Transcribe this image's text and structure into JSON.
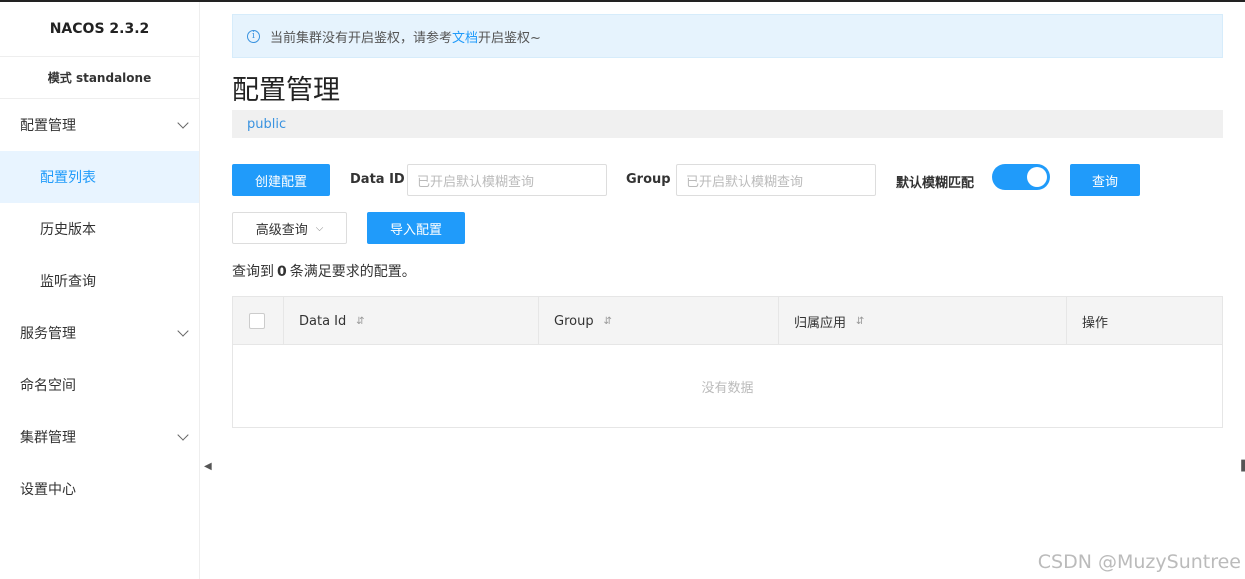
{
  "sidebar": {
    "brand": "NACOS 2.3.2",
    "mode": "模式 standalone",
    "items": [
      {
        "label": "配置管理"
      },
      {
        "label": "配置列表"
      },
      {
        "label": "历史版本"
      },
      {
        "label": "监听查询"
      },
      {
        "label": "服务管理"
      },
      {
        "label": "命名空间"
      },
      {
        "label": "集群管理"
      },
      {
        "label": "设置中心"
      }
    ]
  },
  "notice": {
    "icon": "info-icon",
    "text_before": "当前集群没有开启鉴权，请参考",
    "link": "文档",
    "text_after": "开启鉴权~"
  },
  "page": {
    "title": "配置管理",
    "namespace": "public"
  },
  "toolbar": {
    "create_label": "创建配置",
    "dataid_label": "Data ID",
    "dataid_placeholder": "已开启默认模糊查询",
    "group_label": "Group",
    "group_placeholder": "已开启默认模糊查询",
    "fuzzy_label": "默认模糊匹配",
    "fuzzy_on": true,
    "query_label": "查询",
    "advanced_label": "高级查询",
    "import_label": "导入配置"
  },
  "result": {
    "prefix": "查询到",
    "count": "0",
    "suffix": "条满足要求的配置。"
  },
  "table": {
    "columns": [
      "Data Id",
      "Group",
      "归属应用",
      "操作"
    ],
    "empty_text": "没有数据"
  },
  "watermark": "CSDN @MuzySuntree",
  "colors": {
    "primary": "#209bfa",
    "active_bg": "#e8f4ff",
    "notice_bg": "#e6f3fd"
  }
}
